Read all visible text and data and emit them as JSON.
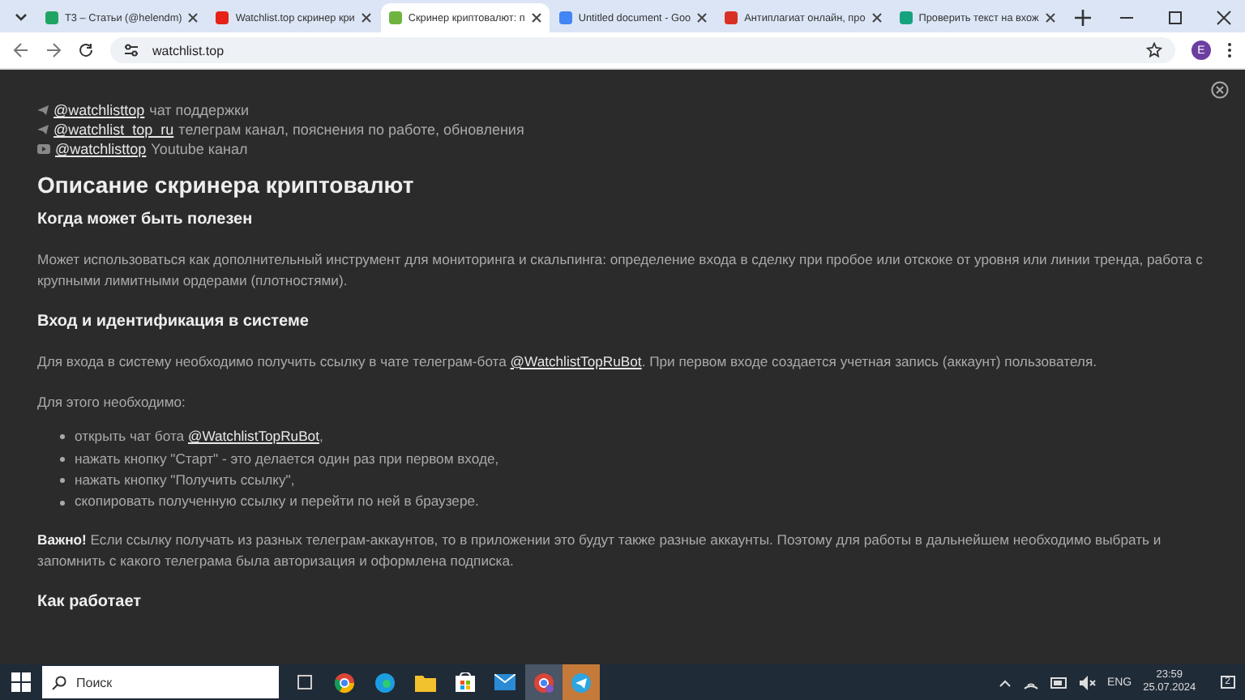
{
  "tabs": [
    {
      "title": "T3 – Статьи (@helendm)",
      "selected": false,
      "color": "#1fa463"
    },
    {
      "title": "Watchlist.top скринер кри",
      "selected": false,
      "color": "#e62117"
    },
    {
      "title": "Скринер криптовалют: п",
      "selected": true,
      "color": "#6fb43f"
    },
    {
      "title": "Untitled document - Goo",
      "selected": false,
      "color": "#4285f4"
    },
    {
      "title": "Антиплагиат онлайн, про",
      "selected": false,
      "color": "#d93025"
    },
    {
      "title": "Проверить текст на вхож",
      "selected": false,
      "color": "#15a37f"
    }
  ],
  "address": {
    "url": "watchlist.top",
    "profile": "E"
  },
  "contacts": [
    {
      "kind": "telegram",
      "link": "@watchlisttop",
      "text": "чат поддержки"
    },
    {
      "kind": "telegram",
      "link": "@watchlist_top_ru",
      "text": "телеграм канал, пояснения по работе, обновления"
    },
    {
      "kind": "youtube",
      "link": "@watchlisttop",
      "text": "Youtube канал"
    }
  ],
  "title": "Описание скринера криптовалют",
  "sections": [
    {
      "heading": "Когда может быть полезен",
      "blocks": [
        {
          "kind": "para",
          "text": "Может использоваться как дополнительный инструмент для мониторинга и скальпинга: определение входа в сделку при пробое или отскоке от уровня или линии тренда, работа с крупными лимитными ордерами (плотностями)."
        }
      ]
    },
    {
      "heading": "Вход и идентификация в системе",
      "blocks": [
        {
          "kind": "linkpara",
          "before": "Для входа в систему необходимо получить ссылку в чате телеграм-бота ",
          "link": "@WatchlistTopRuBot",
          "after": ". При первом входе создается учетная запись (аккаунт) пользователя."
        },
        {
          "kind": "para",
          "text": "Для этого необходимо:"
        },
        {
          "kind": "list",
          "items": [
            {
              "before": "открыть чат бота ",
              "link": "@WatchlistTopRuBot",
              "after": ","
            },
            {
              "before": "нажать кнопку \"Старт\" - это делается один раз при первом входе,"
            },
            {
              "before": "нажать кнопку \"Получить ссылку\","
            },
            {
              "before": "скопировать полученную ссылку и перейти по ней в браузере."
            }
          ]
        },
        {
          "kind": "para",
          "text": "**Важно!** Если ссылку получать из разных телеграм-аккаунтов, то в приложении это будут также разные аккаунты. Поэтому для работы в дальнейшем необходимо выбрать и запомнить с какого телеграма была авторизация и оформлена подписка."
        }
      ]
    },
    {
      "heading": "Как работает"
    }
  ],
  "taskbar": {
    "search_placeholder": "Поиск",
    "language": "ENG",
    "time": "23:59",
    "date": "25.07.2024",
    "notifications": "2"
  }
}
